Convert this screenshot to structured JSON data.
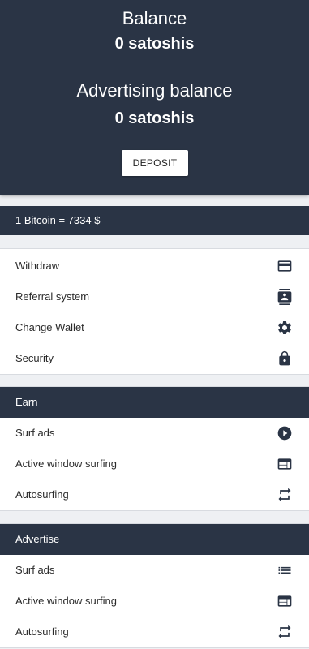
{
  "balance": {
    "title": "Balance",
    "value": "0 satoshis",
    "ad_title": "Advertising balance",
    "ad_value": "0 satoshis",
    "deposit_label": "DEPOSIT"
  },
  "rate": {
    "text": "1 Bitcoin = 7334 $"
  },
  "account_menu": {
    "items": [
      {
        "label": "Withdraw",
        "icon": "credit-card-icon"
      },
      {
        "label": "Referral system",
        "icon": "contacts-icon"
      },
      {
        "label": "Change Wallet",
        "icon": "gear-icon"
      },
      {
        "label": "Security",
        "icon": "lock-icon"
      }
    ]
  },
  "earn": {
    "header": "Earn",
    "items": [
      {
        "label": "Surf ads",
        "icon": "play-circle-icon"
      },
      {
        "label": "Active window surfing",
        "icon": "web-window-icon"
      },
      {
        "label": "Autosurfing",
        "icon": "repeat-icon"
      }
    ]
  },
  "advertise": {
    "header": "Advertise",
    "items": [
      {
        "label": "Surf ads",
        "icon": "list-icon"
      },
      {
        "label": "Active window surfing",
        "icon": "web-window-icon"
      },
      {
        "label": "Autosurfing",
        "icon": "repeat-icon"
      }
    ]
  },
  "colors": {
    "dark": "#2a3445",
    "background": "#eef0f3"
  }
}
